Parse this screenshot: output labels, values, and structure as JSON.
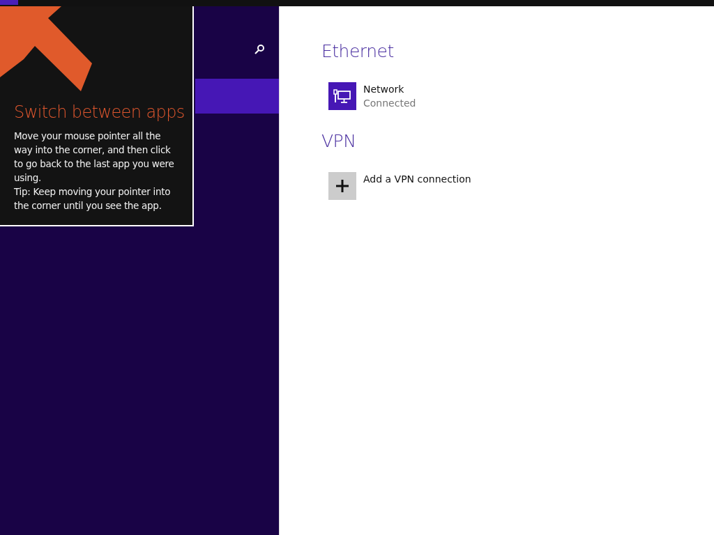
{
  "tip": {
    "title": "Switch between apps",
    "lines": [
      "Move your mouse pointer all the way into the corner, and then click to go back to the last app you were using.",
      "Tip: Keep moving your pointer into the corner until you see the app."
    ]
  },
  "sections": [
    {
      "heading": "Ethernet",
      "items": [
        {
          "kind": "network",
          "name": "Network",
          "status": "Connected"
        }
      ]
    },
    {
      "heading": "VPN",
      "items": [
        {
          "kind": "add",
          "name": "Add a VPN connection"
        }
      ]
    }
  ]
}
